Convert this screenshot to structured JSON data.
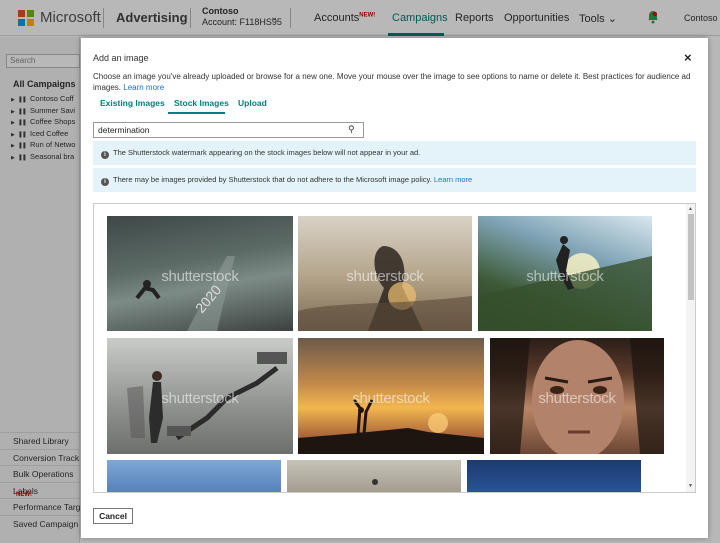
{
  "topbar": {
    "brand": "Microsoft",
    "product": "Advertising",
    "account_name": "Contoso",
    "account_id": "Account: F118HS95",
    "nav": [
      {
        "label": "Accounts",
        "badge": "NEW!"
      },
      {
        "label": "Campaigns"
      },
      {
        "label": "Reports"
      },
      {
        "label": "Opportunities"
      },
      {
        "label": "Tools"
      }
    ],
    "user": "Contoso"
  },
  "sidebar": {
    "search_placeholder": "Search",
    "title": "All Campaigns",
    "campaigns": [
      "Contoso Coff",
      "Summer Savi",
      "Coffee Shops",
      "Iced Coffee",
      "Run of Netwo",
      "Seasonal bra"
    ],
    "bottom_links": [
      "Shared Library",
      "Conversion Track",
      "Bulk Operations",
      "Labels",
      "Performance Targ",
      "Saved Campaign"
    ],
    "new_badge": "NEW!"
  },
  "modal": {
    "title": "Add an image",
    "close_symbol": "×",
    "description": "Choose an image you've already uploaded or browse for a new one. Move your mouse over the image to see options to name or delete it. Best practices for audience ad images.",
    "learn_more": "Learn more",
    "tabs": [
      "Existing Images",
      "Stock Images",
      "Upload"
    ],
    "active_tab": "Stock Images",
    "search_value": "determination",
    "notice1": "The Shutterstock watermark appearing on the stock images below will not appear in your ad.",
    "notice2": "There may be images provided by Shutterstock that do not adhere to the Microsoft image policy.",
    "notice2_link": "Learn more",
    "watermark": "shutterstock",
    "cancel_label": "Cancel"
  },
  "colors": {
    "accent": "#00807c",
    "link": "#1a73c8",
    "notice_bg": "#e4f3f9",
    "new_badge": "#d00000"
  },
  "icons": {
    "logo": "microsoft-logo",
    "account_dropdown": "chevron-down-icon",
    "tools_dropdown": "chevron-down-icon",
    "notifications": "bell-icon",
    "search": "search-icon",
    "info": "info-icon",
    "close": "close-icon"
  },
  "stock_images": [
    {
      "subject": "runner-at-start-2020"
    },
    {
      "subject": "double-exposure-silhouette"
    },
    {
      "subject": "woman-running-stairs"
    },
    {
      "subject": "woman-chalk-wall-finish"
    },
    {
      "subject": "arms-raised-sunset"
    },
    {
      "subject": "intense-woman-face"
    },
    {
      "subject": "partial-row-1"
    },
    {
      "subject": "partial-row-2"
    },
    {
      "subject": "partial-row-3"
    }
  ]
}
